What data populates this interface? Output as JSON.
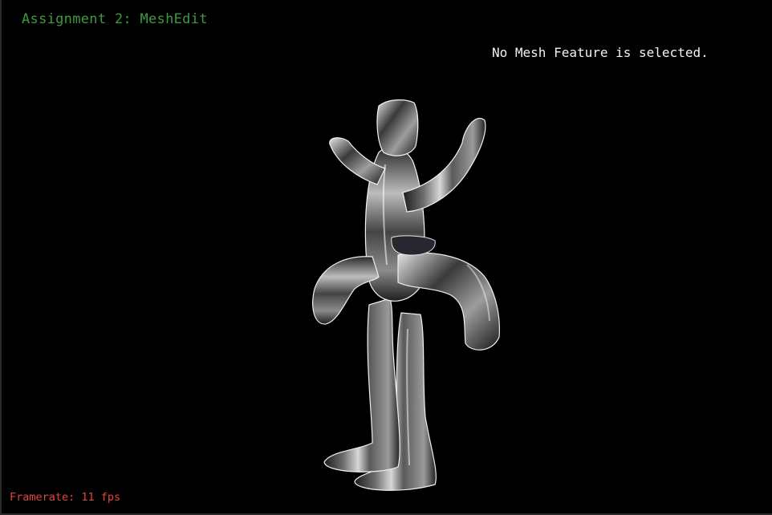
{
  "window": {
    "title": "Assignment 2: MeshEdit"
  },
  "status": {
    "message": "No Mesh Feature is selected."
  },
  "framerate": {
    "label": "Framerate: 11 fps"
  },
  "colors": {
    "background": "#000000",
    "title": "#3e9a3e",
    "status_text": "#f2f2f2",
    "framerate_text": "#e0473c"
  }
}
